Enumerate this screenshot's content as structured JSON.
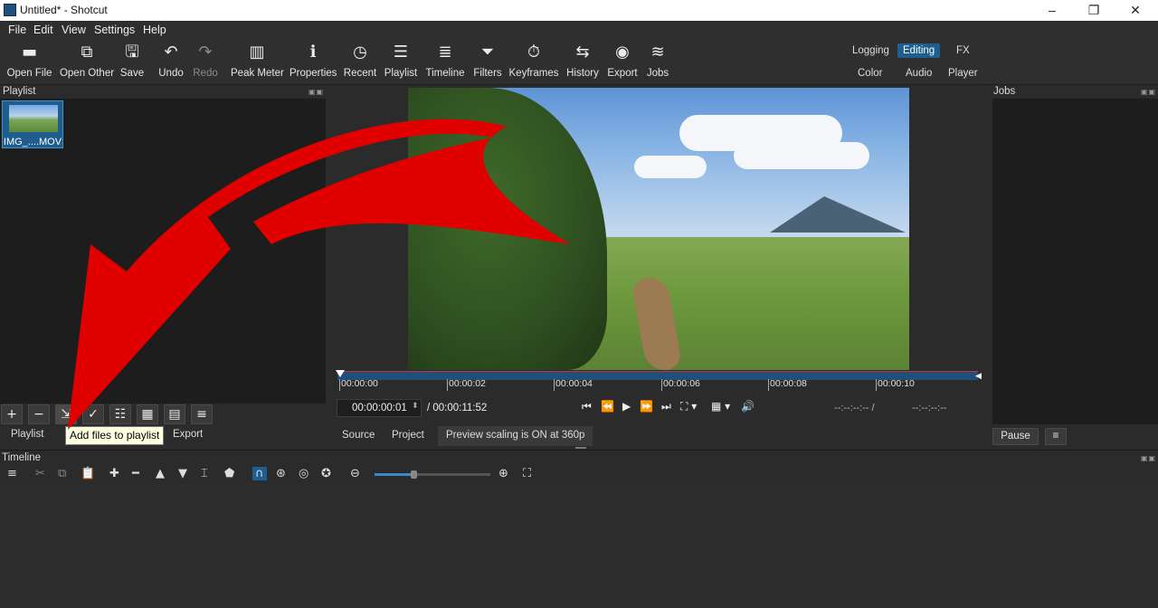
{
  "window": {
    "title": "Untitled* - Shotcut",
    "controls": [
      "–",
      "❐",
      "✕"
    ]
  },
  "menu": [
    "File",
    "Edit",
    "View",
    "Settings",
    "Help"
  ],
  "toolbar": [
    {
      "label": "Open File",
      "icon": "open-file-icon",
      "glyph": "▬"
    },
    {
      "label": "Open Other",
      "icon": "open-other-icon",
      "glyph": "⧉"
    },
    {
      "label": "Save",
      "icon": "save-icon",
      "glyph": "🖫"
    },
    {
      "label": "Undo",
      "icon": "undo-icon",
      "glyph": "↶"
    },
    {
      "label": "Redo",
      "icon": "redo-icon",
      "glyph": "↷"
    },
    {
      "label": "Peak Meter",
      "icon": "peak-meter-icon",
      "glyph": "▥"
    },
    {
      "label": "Properties",
      "icon": "properties-icon",
      "glyph": "ℹ"
    },
    {
      "label": "Recent",
      "icon": "recent-icon",
      "glyph": "◷"
    },
    {
      "label": "Playlist",
      "icon": "playlist-icon",
      "glyph": "☰"
    },
    {
      "label": "Timeline",
      "icon": "timeline-icon",
      "glyph": "≣"
    },
    {
      "label": "Filters",
      "icon": "filters-icon",
      "glyph": "⏷"
    },
    {
      "label": "Keyframes",
      "icon": "keyframes-icon",
      "glyph": "⏱"
    },
    {
      "label": "History",
      "icon": "history-icon",
      "glyph": "⇆"
    },
    {
      "label": "Export",
      "icon": "export-icon",
      "glyph": "◉"
    },
    {
      "label": "Jobs",
      "icon": "jobs-icon",
      "glyph": "≋"
    }
  ],
  "layouts": {
    "row1": [
      "Logging",
      "Editing",
      "FX"
    ],
    "row2": [
      "Color",
      "Audio",
      "Player"
    ],
    "active": "Editing"
  },
  "playlist": {
    "title": "Playlist",
    "items": [
      {
        "name": "IMG_....MOV"
      }
    ],
    "buttons": [
      "+",
      "−",
      "⇲",
      "✓",
      "☷",
      "▦",
      "▤",
      "≡"
    ],
    "tabs": [
      "Playlist",
      "Export"
    ],
    "tooltip": "Add files to playlist"
  },
  "viewer": {
    "ticks": [
      "00:00:00",
      "00:00:02",
      "00:00:04",
      "00:00:06",
      "00:00:08",
      "00:00:10"
    ],
    "current_time": "00:00:00:01",
    "duration": "/ 00:00:11:52",
    "in_point": "--:--:--:-- /",
    "out_point": "--:--:--:--",
    "tabs": [
      "Source",
      "Project"
    ],
    "scaling_notice": "Preview scaling is ON at 360p",
    "transport": [
      "⏮",
      "⏪",
      "▶",
      "⏩",
      "⏭",
      "⛶ ▾",
      "▦ ▾",
      "🔊"
    ]
  },
  "jobs": {
    "title": "Jobs",
    "pause_label": "Pause",
    "menu_glyph": "≡"
  },
  "timeline": {
    "title": "Timeline",
    "tools": [
      "≡",
      "✂",
      "⧉",
      "📋",
      "✚",
      "━",
      "▲",
      "▼",
      "⌶",
      "⬟",
      "∩",
      "⊛",
      "◎",
      "✪",
      "⊖",
      "⊕",
      "⛶"
    ]
  },
  "colors": {
    "accent": "#1f5f8f",
    "scrubber": "#1f4f7a",
    "arrow": "#e00000",
    "background": "#2b2b2b"
  }
}
